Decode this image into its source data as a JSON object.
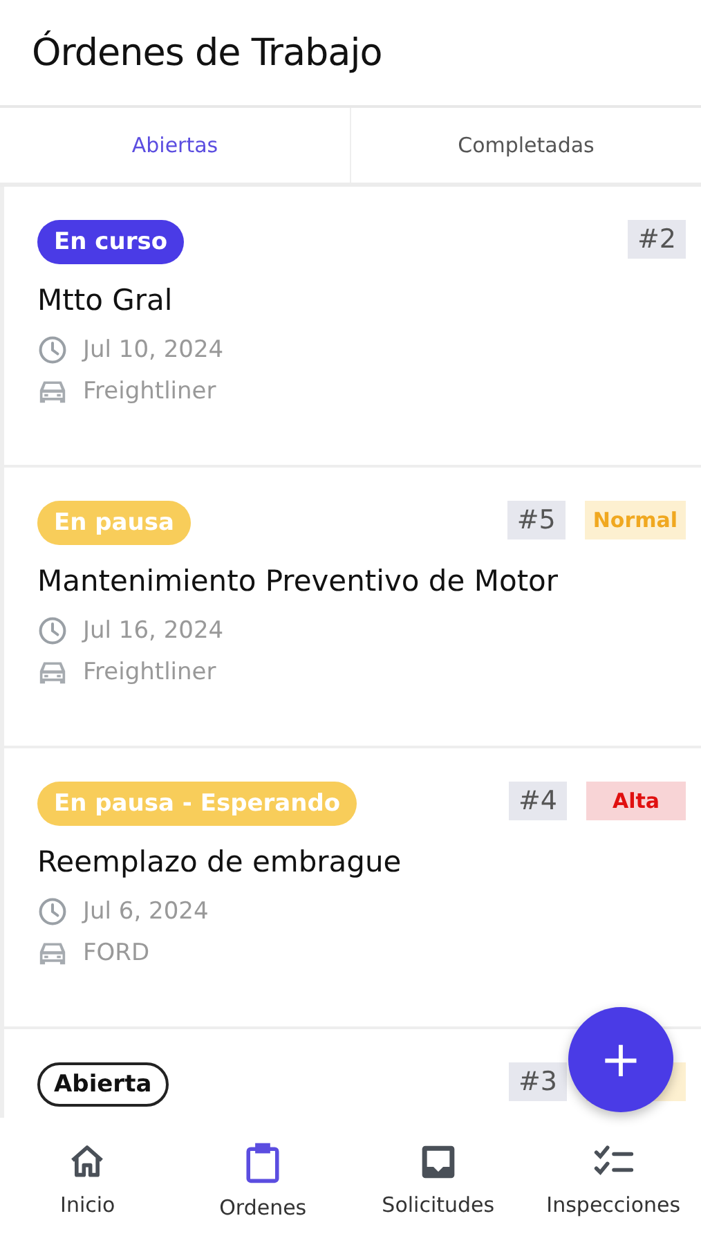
{
  "header": {
    "title": "Órdenes de Trabajo"
  },
  "tabs": [
    {
      "label": "Abiertas",
      "selected": true
    },
    {
      "label": "Completadas",
      "selected": false
    }
  ],
  "orders": [
    {
      "status": {
        "label": "En curso",
        "kind": "in_progress"
      },
      "number": "#2",
      "title": "Mtto Gral",
      "date": "Jul 10, 2024",
      "vehicle": "Freightliner"
    },
    {
      "status": {
        "label": "En pausa",
        "kind": "paused"
      },
      "number": "#5",
      "priority": {
        "label": "Normal",
        "kind": "normal"
      },
      "title": "Mantenimiento Preventivo de Motor",
      "date": "Jul 16, 2024",
      "vehicle": "Freightliner"
    },
    {
      "status": {
        "label": "En pausa - Esperando",
        "kind": "paused"
      },
      "number": "#4",
      "priority": {
        "label": "Alta",
        "kind": "high"
      },
      "title": "Reemplazo de embrague",
      "date": "Jul 6, 2024",
      "vehicle": "FORD"
    },
    {
      "status": {
        "label": "Abierta",
        "kind": "open"
      },
      "number": "#3",
      "priority": {
        "kind": "normal"
      }
    }
  ],
  "fab": {
    "label": "+"
  },
  "nav": [
    {
      "label": "Inicio",
      "kind": "home",
      "selected": false
    },
    {
      "label": "Ordenes",
      "kind": "clipboard",
      "selected": true
    },
    {
      "label": "Solicitudes",
      "kind": "inbox",
      "selected": false
    },
    {
      "label": "Inspecciones",
      "kind": "checklist",
      "selected": false
    }
  ]
}
